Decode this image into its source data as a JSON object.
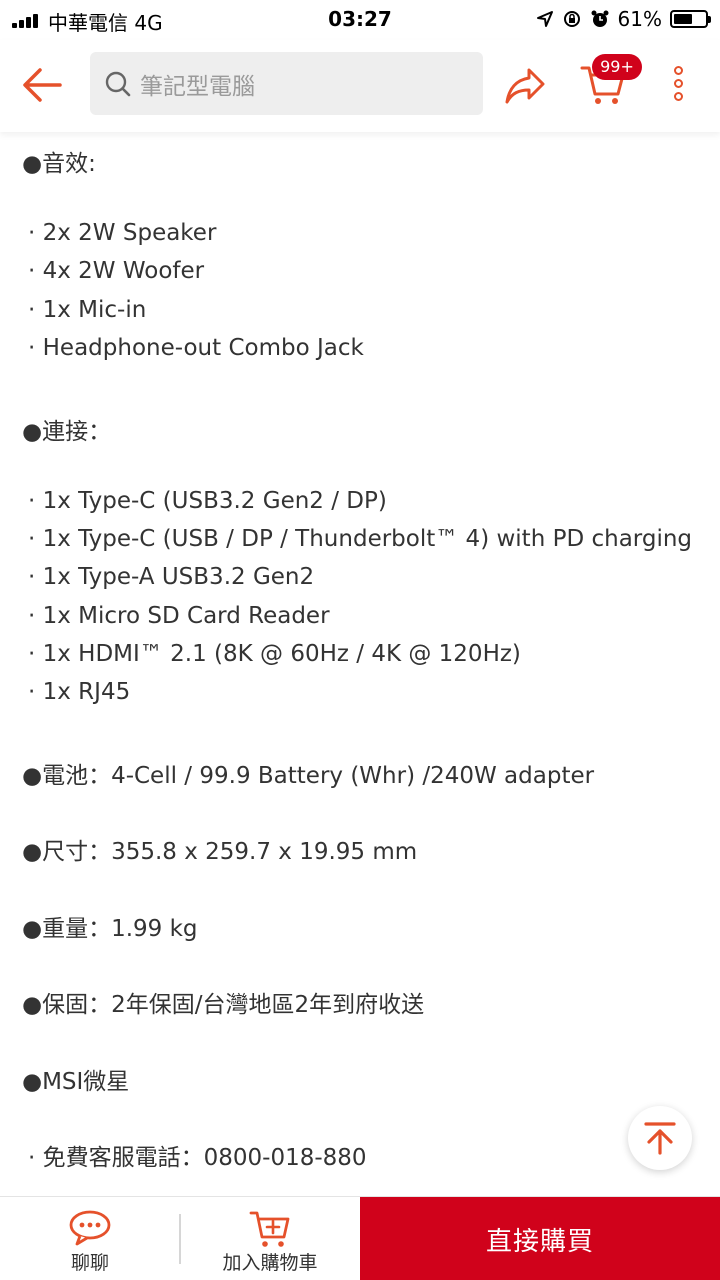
{
  "status_bar": {
    "carrier": "中華電信  4G",
    "time": "03:27",
    "battery_text": "61%",
    "battery_level": 0.61
  },
  "header": {
    "search_placeholder": "筆記型電腦",
    "cart_badge": "99+",
    "icons": [
      "back-arrow-icon",
      "search-icon",
      "share-icon",
      "cart-icon",
      "more-icon"
    ],
    "accent_color": "#e5512b"
  },
  "spec_lines": [
    "●音效:",
    "· 2x 2W Speaker",
    "· 4x 2W Woofer",
    "· 1x Mic-in",
    "· Headphone-out Combo Jack",
    "●連接：",
    "· 1x Type-C (USB3.2 Gen2 / DP)",
    "· 1x Type-C (USB / DP / Thunderbolt™ 4) with PD charging",
    "· 1x Type-A USB3.2 Gen2",
    "· 1x Micro SD Card Reader",
    "· 1x HDMI™ 2.1 (8K @ 60Hz / 4K @ 120Hz)",
    "· 1x RJ45",
    "●電池：4-Cell / 99.9 Battery (Whr) /240W adapter",
    "●尺寸：355.8 x 259.7 x 19.95 mm",
    "●重量：1.99 kg",
    "●保固：2年保固/台灣地區2年到府收送",
    "●MSI微星",
    "· 免費客服電話：0800-018-880"
  ],
  "bottom_bar": {
    "chat_label": "聊聊",
    "add_to_cart_label": "加入購物車",
    "buy_now_label": "直接購買",
    "buy_color": "#d0021b"
  }
}
